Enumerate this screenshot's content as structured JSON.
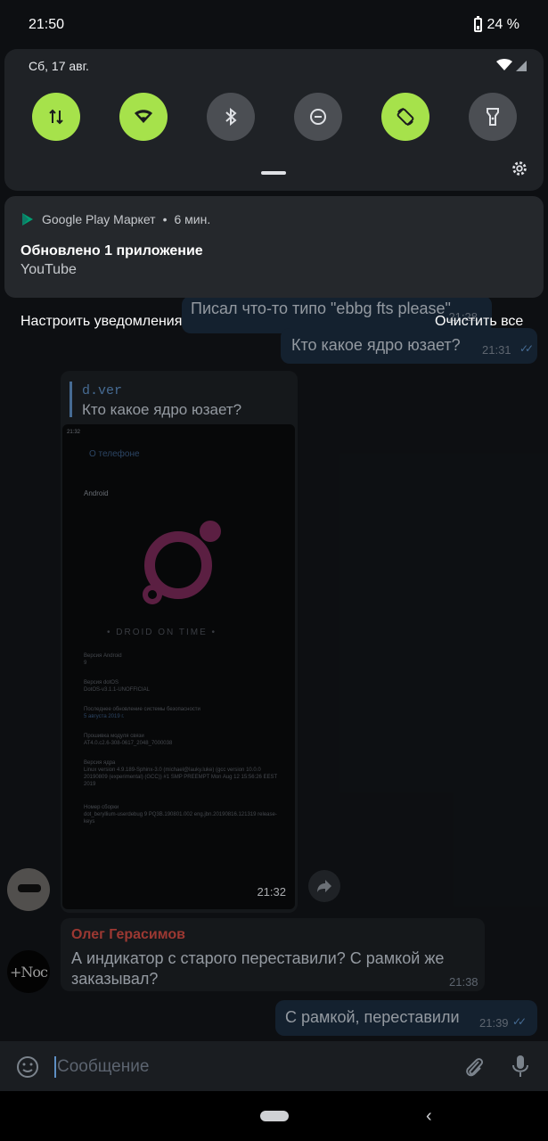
{
  "status_bar": {
    "time": "21:50",
    "battery_percent": "24 %"
  },
  "quick_settings": {
    "date": "Сб, 17 авг.",
    "tiles": [
      {
        "icon": "data-transfer-icon",
        "active": true
      },
      {
        "icon": "wifi-icon",
        "active": true
      },
      {
        "icon": "bluetooth-icon",
        "active": false
      },
      {
        "icon": "dnd-icon",
        "active": false
      },
      {
        "icon": "auto-rotate-icon",
        "active": true
      },
      {
        "icon": "flashlight-icon",
        "active": false
      }
    ]
  },
  "notification": {
    "app": "Google Play Маркет",
    "dot": "•",
    "age": "6 мин.",
    "title": "Обновлено 1 приложение",
    "body": "YouTube"
  },
  "notification_actions": {
    "manage": "Настроить уведомления",
    "clear": "Очистить все"
  },
  "chat": {
    "messages": [
      {
        "text": "Писал что-то типо \"ebbg fts please\"",
        "time": "21:28"
      },
      {
        "text": "Кто какое ядро юзает?",
        "time": "21:31"
      }
    ],
    "reply": {
      "author": "d.ver",
      "quoted": "Кто какое ядро юзает?",
      "media_time": "21:32"
    },
    "screenshot": {
      "time": "21:32",
      "title": "О телефоне",
      "android": "Android",
      "brand": "• DROID ON TIME •",
      "lines": [
        "Версия Android",
        "9",
        "Версия dotOS",
        "DotOS-v3.1.1-UNOFFICIAL",
        "Последнее обновление системы безопасности",
        "5 августа 2019 г.",
        "Прошивка модуля связи",
        "AT4.0.c2.6-308-0617_2048_7000038",
        "Версия ядра",
        "Linux version 4.9.189-Sphinx-3.0 (michael@lauky.luke) (gcc version 10.0.0 20190809 (experimental) (GCC)) #1 SMP PREEMPT Mon Aug 12 15:56:26 EEST 2019",
        "Номер сборки",
        "dot_beryllium-userdebug 9 PQ3B.190801.002 eng.jbn.20190816.121319 release-keys"
      ]
    },
    "incoming": {
      "author": "Олег Герасимов",
      "text": "А индикатор с старого переставили? С рамкой же заказывал?",
      "time": "21:38"
    },
    "last": {
      "text": "С рамкой, переставили",
      "time": "21:39"
    }
  },
  "input": {
    "placeholder": "Сообщение"
  },
  "colors": {
    "accent_tile": "#a6e24b",
    "author_red": "#d04b43",
    "link_blue": "#5e8fc4"
  }
}
